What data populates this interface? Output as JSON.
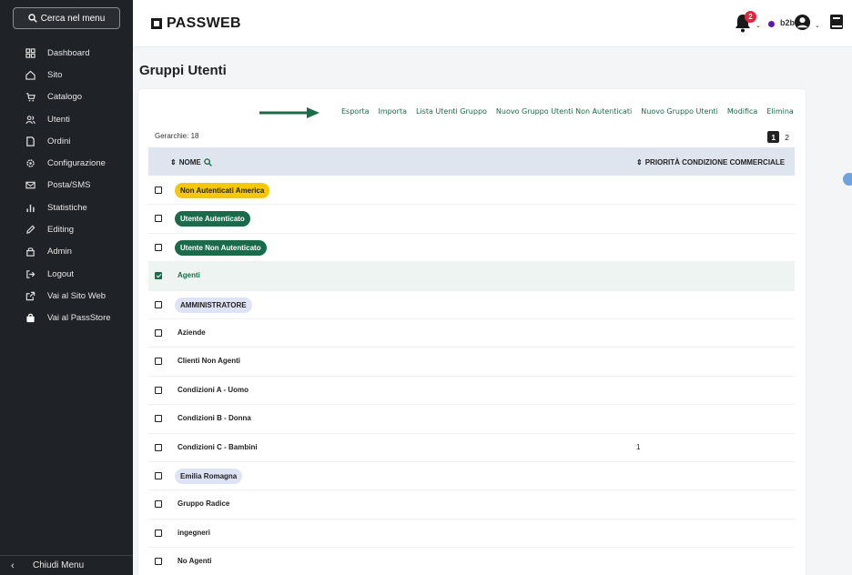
{
  "sidebar": {
    "search_label": "Cerca nel menu",
    "items": [
      {
        "label": "Dashboard",
        "icon": "dashboard-icon"
      },
      {
        "label": "Sito",
        "icon": "home-icon"
      },
      {
        "label": "Catalogo",
        "icon": "cart-icon"
      },
      {
        "label": "Utenti",
        "icon": "users-icon"
      },
      {
        "label": "Ordini",
        "icon": "orders-icon"
      },
      {
        "label": "Configurazione",
        "icon": "gear-icon"
      },
      {
        "label": "Posta/SMS",
        "icon": "mail-icon"
      },
      {
        "label": "Statistiche",
        "icon": "stats-icon"
      },
      {
        "label": "Editing",
        "icon": "pencil-icon"
      },
      {
        "label": "Admin",
        "icon": "admin-icon"
      },
      {
        "label": "Logout",
        "icon": "logout-icon"
      },
      {
        "label": "Vai al Sito Web",
        "icon": "external-link-icon"
      },
      {
        "label": "Vai al PassStore",
        "icon": "bag-icon"
      }
    ],
    "footer_label": "Chiudi Menu"
  },
  "header": {
    "logo": "PASSWEB",
    "notification_count": "2",
    "user_label": "b2b",
    "status_color": "#5a1aa8"
  },
  "page": {
    "title": "Gruppi Utenti"
  },
  "toolbar": {
    "actions": [
      "Esporta",
      "Importa",
      "Lista Utenti Gruppo",
      "Nuovo Gruppo Utenti Non Autenticati",
      "Nuovo Gruppo Utenti",
      "Modifica",
      "Elimina"
    ]
  },
  "list": {
    "count_label": "Gerarchie: 18",
    "pages": [
      "1",
      "2"
    ],
    "current_page": "1",
    "columns": {
      "name": "NOME",
      "priority": "PRIORITÀ CONDIZIONE COMMERCIALE"
    },
    "rows": [
      {
        "name": "Non Autenticati America",
        "style": "yellow",
        "checked": false,
        "priority": ""
      },
      {
        "name": "Utente Autenticato",
        "style": "green",
        "checked": false,
        "priority": ""
      },
      {
        "name": "Utente Non Autenticato",
        "style": "green",
        "checked": false,
        "priority": ""
      },
      {
        "name": "Agenti",
        "style": "selected",
        "checked": true,
        "priority": ""
      },
      {
        "name": "AMMINISTRATORE",
        "style": "lavender",
        "checked": false,
        "priority": ""
      },
      {
        "name": "Aziende",
        "style": "plain",
        "checked": false,
        "priority": ""
      },
      {
        "name": "Clienti Non Agenti",
        "style": "plain",
        "checked": false,
        "priority": ""
      },
      {
        "name": "Condizioni A - Uomo",
        "style": "plain",
        "checked": false,
        "priority": ""
      },
      {
        "name": "Condizioni B - Donna",
        "style": "plain",
        "checked": false,
        "priority": ""
      },
      {
        "name": "Condizioni C - Bambini",
        "style": "plain",
        "checked": false,
        "priority": "1"
      },
      {
        "name": "Emilia Romagna",
        "style": "lavender",
        "checked": false,
        "priority": ""
      },
      {
        "name": "Gruppo Radice",
        "style": "plain",
        "checked": false,
        "priority": ""
      },
      {
        "name": "ingegneri",
        "style": "plain",
        "checked": false,
        "priority": ""
      },
      {
        "name": "No Agenti",
        "style": "plain",
        "checked": false,
        "priority": ""
      }
    ]
  },
  "colors": {
    "accent": "#1a6b4a",
    "sidebar_bg": "#1f2226",
    "header_row": "#dfe5ef",
    "badge": "#e0263a"
  }
}
